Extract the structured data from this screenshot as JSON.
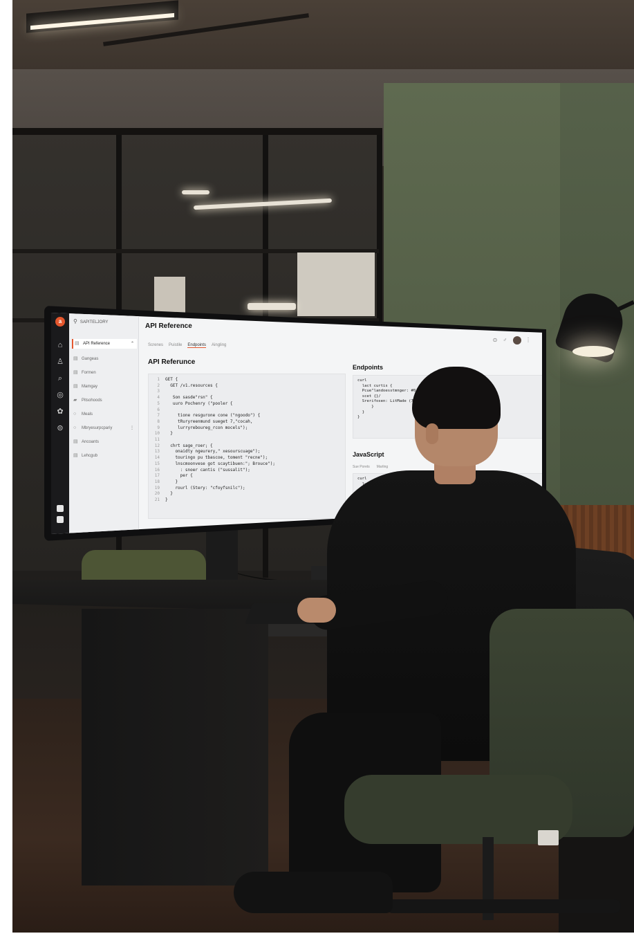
{
  "screen": {
    "search_label": "SAPITELJORY",
    "app_title": "API Reference",
    "nav": [
      {
        "icon": "doc-icon",
        "label": "API Reference",
        "active": true
      },
      {
        "icon": "doc-icon",
        "label": "Gangeas"
      },
      {
        "icon": "doc-icon",
        "label": "Formen"
      },
      {
        "icon": "doc-icon",
        "label": "Mamgay"
      },
      {
        "icon": "folder-icon",
        "label": "Pitsohoods"
      },
      {
        "icon": "doc-icon",
        "label": "Meals"
      },
      {
        "icon": "doc-icon",
        "label": "Mbryesurpcpariy"
      },
      {
        "icon": "doc-icon",
        "label": "Ancoants"
      },
      {
        "icon": "doc-icon",
        "label": "Lehcgub"
      }
    ],
    "tabs": [
      "Screnes",
      "Puistile",
      "Endpoints",
      "Aingling"
    ],
    "active_tab": "Endpoints",
    "section_title": "API Referunce",
    "code_lines": [
      {
        "n": "1",
        "t": "GET {"
      },
      {
        "n": "2",
        "t": "  GET /v1.resources {"
      },
      {
        "n": "3",
        "t": ""
      },
      {
        "n": "4",
        "t": "   Son sasde\"rsn\" {"
      },
      {
        "n": "5",
        "t": "   uuro Pochenry (\"pooler {"
      },
      {
        "n": "6",
        "t": ""
      },
      {
        "n": "7",
        "t": "     tione resgurone cone (\"ngoodo\") {"
      },
      {
        "n": "8",
        "t": "     tRuryreenmund sueget 7,\"cocah,"
      },
      {
        "n": "9",
        "t": "     lurryreboureg_rcon mocels\");"
      },
      {
        "n": "10",
        "t": "  }"
      },
      {
        "n": "11",
        "t": ""
      },
      {
        "n": "12",
        "t": "  chrt sage_roer; {"
      },
      {
        "n": "13",
        "t": "    onaidty ngeurery,\" xesourscuage\");"
      },
      {
        "n": "14",
        "t": "    touringo pu tbascoe, toment \"recne\");"
      },
      {
        "n": "15",
        "t": "    lnscmoonvese got scaytibuen:\"; Brouce\");"
      },
      {
        "n": "16",
        "t": "      : snoer cantis (\"sussalit\");"
      },
      {
        "n": "17",
        "t": "      per {"
      },
      {
        "n": "18",
        "t": "    }"
      },
      {
        "n": "19",
        "t": "    rourl (Stery: \"cfoyfsnilc\");"
      },
      {
        "n": "20",
        "t": "  }"
      },
      {
        "n": "21",
        "t": "}"
      }
    ],
    "endpoints_title": "Endpoints",
    "endpoints_code": "curl\n  lact curtis {\n  Pcue\"landoesstmnger: #0\n  scet {}/\n  Srerifosen: LitMade (7w\n      }\n  }\n}",
    "js_title": "JavaScript",
    "js_tabs": [
      "Sue Porets",
      "Marling"
    ],
    "js_code": "curl\n  lurt Bwrtr: t47_1: \");\n  tort {}\n  tcet lurtr: 7F_OK\"),\n  lirt {{"
  }
}
